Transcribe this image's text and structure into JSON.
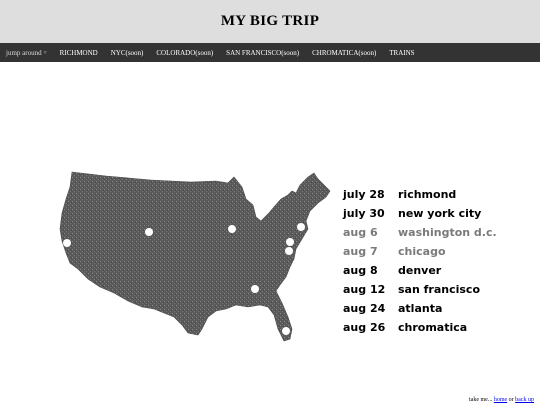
{
  "header": {
    "title": "MY BIG TRIP"
  },
  "nav": {
    "dropdown": {
      "label": "jump around",
      "icon": "caret-down-icon"
    },
    "items": [
      {
        "label": "RICHMOND"
      },
      {
        "label": "NYC(soon)"
      },
      {
        "label": "COLORADO(soon)"
      },
      {
        "label": "SAN FRANCISCO(soon)"
      },
      {
        "label": "CHROMATICA(soon)"
      },
      {
        "label": "TRAINS"
      }
    ]
  },
  "map": {
    "icon": "usa-map-icon",
    "marker_color": "#ffffff",
    "land_color": "#5a5a5a"
  },
  "schedule": [
    {
      "date": "july 28",
      "place": "richmond",
      "color": "#000000"
    },
    {
      "date": "july 30",
      "place": "new york city",
      "color": "#000000"
    },
    {
      "date": "aug 6",
      "place": "washington d.c.",
      "color": "#7a7a7a"
    },
    {
      "date": "aug 7",
      "place": "chicago",
      "color": "#7a7a7a"
    },
    {
      "date": "aug 8",
      "place": "denver",
      "color": "#000000"
    },
    {
      "date": "aug 12",
      "place": "san francisco",
      "color": "#000000"
    },
    {
      "date": "aug 24",
      "place": "atlanta",
      "color": "#000000"
    },
    {
      "date": "aug 26",
      "place": "chromatica",
      "color": "#000000"
    }
  ],
  "footer": {
    "prefix": "take me...",
    "home": "home",
    "or": "or",
    "back": "back up"
  }
}
